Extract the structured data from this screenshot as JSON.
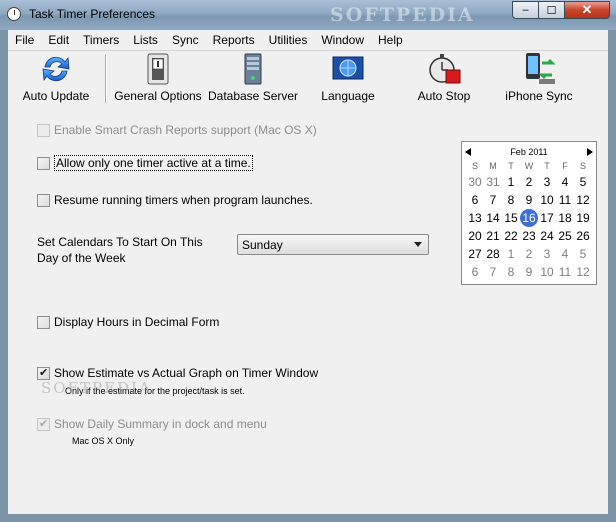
{
  "window": {
    "title": "Task Timer Preferences",
    "watermark": "SOFTPEDIA",
    "minimize": "–",
    "maximize": "☐",
    "close": "✕"
  },
  "menu": [
    "File",
    "Edit",
    "Timers",
    "Lists",
    "Sync",
    "Reports",
    "Utilities",
    "Window",
    "Help"
  ],
  "toolbar": [
    {
      "label": "Auto Update",
      "icon": "refresh-arrows-icon"
    },
    {
      "label": "General Options",
      "icon": "toggle-switch-icon"
    },
    {
      "label": "Database Server",
      "icon": "server-tower-icon"
    },
    {
      "label": "Language",
      "icon": "globe-screen-icon"
    },
    {
      "label": "Auto Stop",
      "icon": "stopwatch-stop-icon"
    },
    {
      "label": "iPhone Sync",
      "icon": "iphone-sync-icon"
    }
  ],
  "options": {
    "crash_reports": {
      "label": "Enable Smart Crash Reports support (Mac OS X)",
      "checked": false,
      "disabled": true
    },
    "one_timer": {
      "label": "Allow only one timer active at a time.",
      "checked": false
    },
    "resume_timers": {
      "label": "Resume running timers when program launches.",
      "checked": false
    },
    "calendar_start": {
      "label": "Set Calendars To Start On This Day of the Week",
      "value": "Sunday"
    },
    "decimal_hours": {
      "label": "Display Hours in Decimal Form",
      "checked": false
    },
    "estimate_graph": {
      "label": "Show Estimate vs Actual Graph on Timer Window",
      "checked": true,
      "note": "Only if the estimate for the project/task is set."
    },
    "daily_summary": {
      "label": "Show Daily Summary in dock and menu",
      "checked": true,
      "disabled": true,
      "note": "Mac OS X Only"
    }
  },
  "calendar": {
    "title": "Feb 2011",
    "weekdays": [
      "S",
      "M",
      "T",
      "W",
      "T",
      "F",
      "S"
    ],
    "days": [
      {
        "n": "30",
        "other": true
      },
      {
        "n": "31",
        "other": true
      },
      {
        "n": "1"
      },
      {
        "n": "2"
      },
      {
        "n": "3"
      },
      {
        "n": "4"
      },
      {
        "n": "5"
      },
      {
        "n": "6"
      },
      {
        "n": "7"
      },
      {
        "n": "8"
      },
      {
        "n": "9"
      },
      {
        "n": "10"
      },
      {
        "n": "11"
      },
      {
        "n": "12"
      },
      {
        "n": "13"
      },
      {
        "n": "14"
      },
      {
        "n": "15"
      },
      {
        "n": "16",
        "selected": true
      },
      {
        "n": "17"
      },
      {
        "n": "18"
      },
      {
        "n": "19"
      },
      {
        "n": "20"
      },
      {
        "n": "21"
      },
      {
        "n": "22"
      },
      {
        "n": "23"
      },
      {
        "n": "24"
      },
      {
        "n": "25"
      },
      {
        "n": "26"
      },
      {
        "n": "27"
      },
      {
        "n": "28"
      },
      {
        "n": "1",
        "other": true
      },
      {
        "n": "2",
        "other": true
      },
      {
        "n": "3",
        "other": true
      },
      {
        "n": "4",
        "other": true
      },
      {
        "n": "5",
        "other": true
      },
      {
        "n": "6",
        "other": true
      },
      {
        "n": "7",
        "other": true
      },
      {
        "n": "8",
        "other": true
      },
      {
        "n": "9",
        "other": true
      },
      {
        "n": "10",
        "other": true
      },
      {
        "n": "11",
        "other": true
      },
      {
        "n": "12",
        "other": true
      }
    ]
  },
  "content_watermark": "SOFTPEDIA"
}
